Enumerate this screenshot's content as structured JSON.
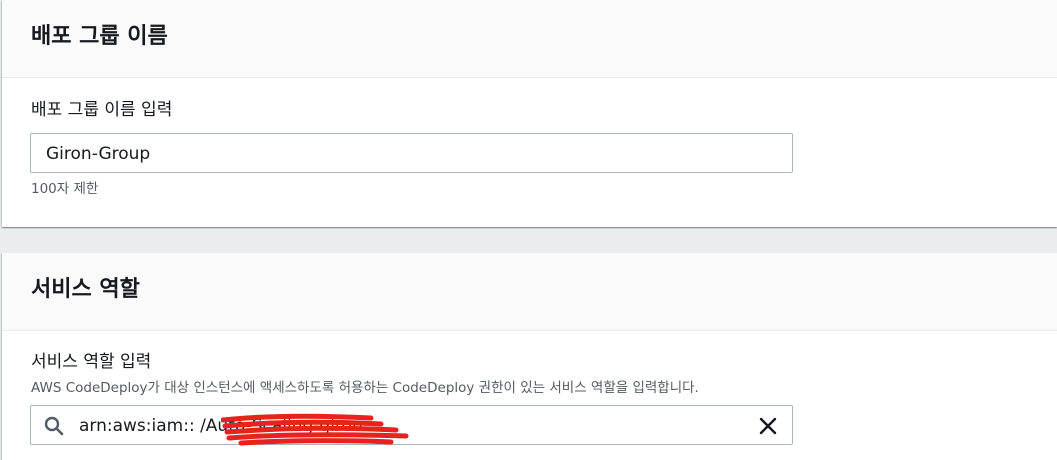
{
  "deployment_group_section": {
    "title": "배포 그룹 이름",
    "field_label": "배포 그룹 이름 입력",
    "input_value": "Giron-Group",
    "constraint": "100자 제한"
  },
  "service_role_section": {
    "title": "서비스 역할",
    "field_label": "서비스 역할 입력",
    "description": "AWS CodeDeploy가 대상 인스턴스에 액세스하도록 허용하는 CodeDeploy 권한이 있는 서비스 역할을 입력합니다.",
    "input_value": "arn:aws:iam::                                       /Auto-Scaling-giron",
    "search_icon": "search-icon",
    "clear_icon": "close-icon"
  },
  "colors": {
    "redaction": "#e8231d",
    "border": "#aab7b8",
    "header_bg": "#fafafa",
    "page_bg": "#eaeded"
  }
}
